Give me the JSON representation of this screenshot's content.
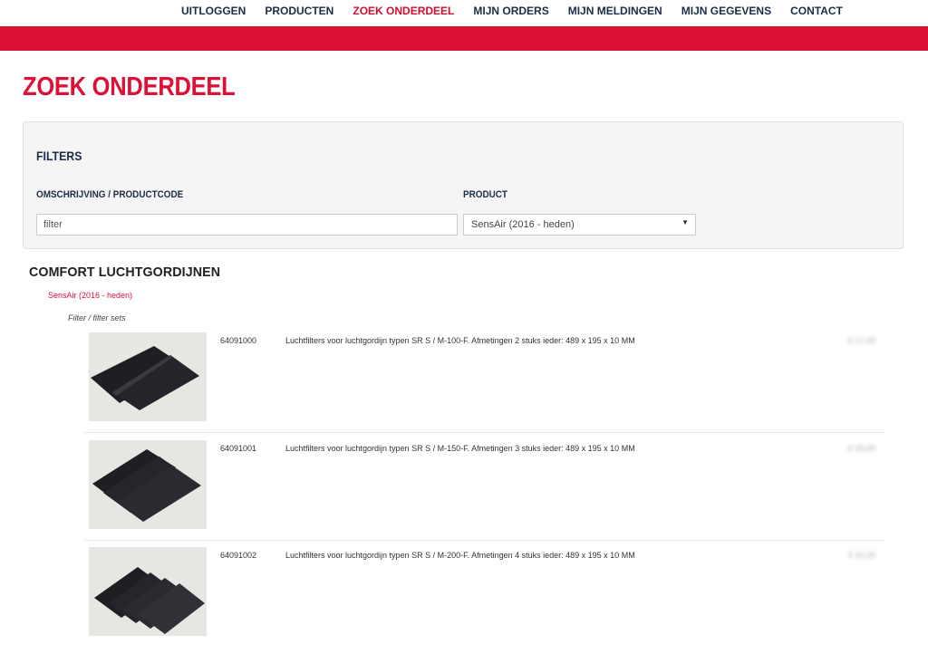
{
  "nav": {
    "items": [
      "UITLOGGEN",
      "PRODUCTEN",
      "ZOEK ONDERDEEL",
      "MIJN ORDERS",
      "MIJN MELDINGEN",
      "MIJN GEGEVENS",
      "CONTACT"
    ],
    "active": "ZOEK ONDERDEEL"
  },
  "page": {
    "title": "ZOEK ONDERDEEL"
  },
  "filters": {
    "title": "FILTERS",
    "description_label": "OMSCHRIJVING / PRODUCTCODE",
    "description_placeholder": "filter",
    "product_label": "PRODUCT",
    "product_selected": "SensAir (2016 - heden)"
  },
  "results": {
    "category": "COMFORT LUCHTGORDIJNEN",
    "subcategory": "SensAir (2016 - heden)",
    "group": "Filter / filter sets",
    "items": [
      {
        "code": "64091000",
        "description": "Luchtfilters voor luchtgordijn typen SR S / M-100-F. Afmetingen 2 stuks ieder: 489 x 195 x 10 MM",
        "price": "€ 17,00"
      },
      {
        "code": "64091001",
        "description": "Luchtfilters voor luchtgordijn typen SR S / M-150-F. Afmetingen 3 stuks ieder: 489 x 195 x 10 MM",
        "price": "€ 33,00"
      },
      {
        "code": "64091002",
        "description": "Luchtfilters voor luchtgordijn typen SR S / M-200-F. Afmetingen 4 stuks ieder: 489 x 195 x 10 MM",
        "price": "€ 42,00"
      }
    ]
  },
  "colors": {
    "brand_red": "#dd1037",
    "navy": "#1d2c45",
    "panel_bg": "#f5f5f5"
  }
}
